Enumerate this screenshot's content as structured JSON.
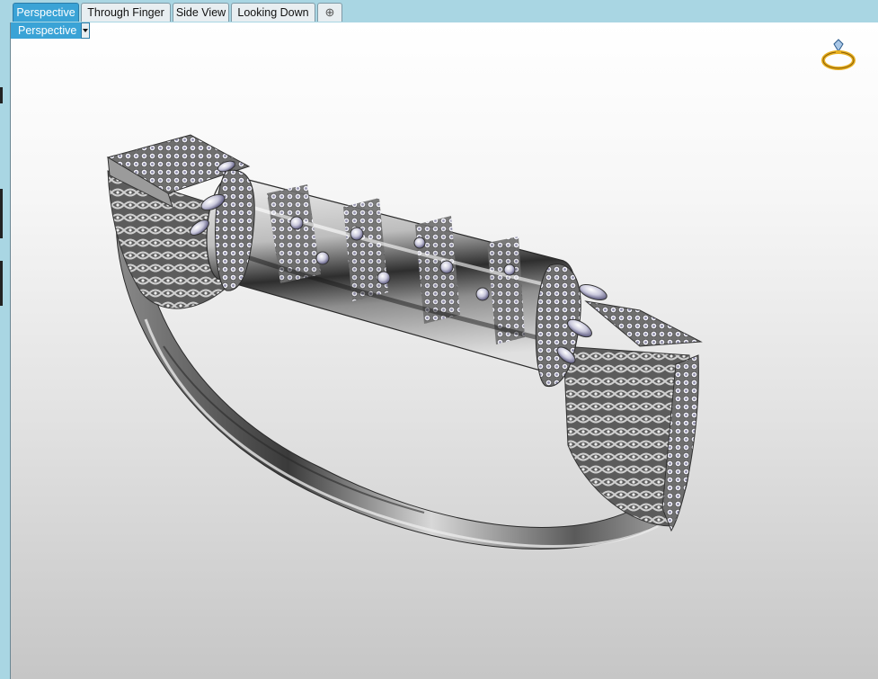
{
  "tabs": [
    {
      "label": "Perspective",
      "active": true
    },
    {
      "label": "Through Finger",
      "active": false
    },
    {
      "label": "Side View",
      "active": false
    },
    {
      "label": "Looking Down",
      "active": false
    }
  ],
  "add_tab_icon": "plus-icon",
  "viewport": {
    "view_selector": "Perspective",
    "dropdown_icon": "chevron-down-icon",
    "corner_icon": "ring-icon",
    "model": "jeweled-bangle-3d-model"
  },
  "colors": {
    "tab_active": "#3aa3d6",
    "tab_bar": "#a9d6e3",
    "metal": "#9a9a9a",
    "icon_gold": "#e8b020"
  }
}
